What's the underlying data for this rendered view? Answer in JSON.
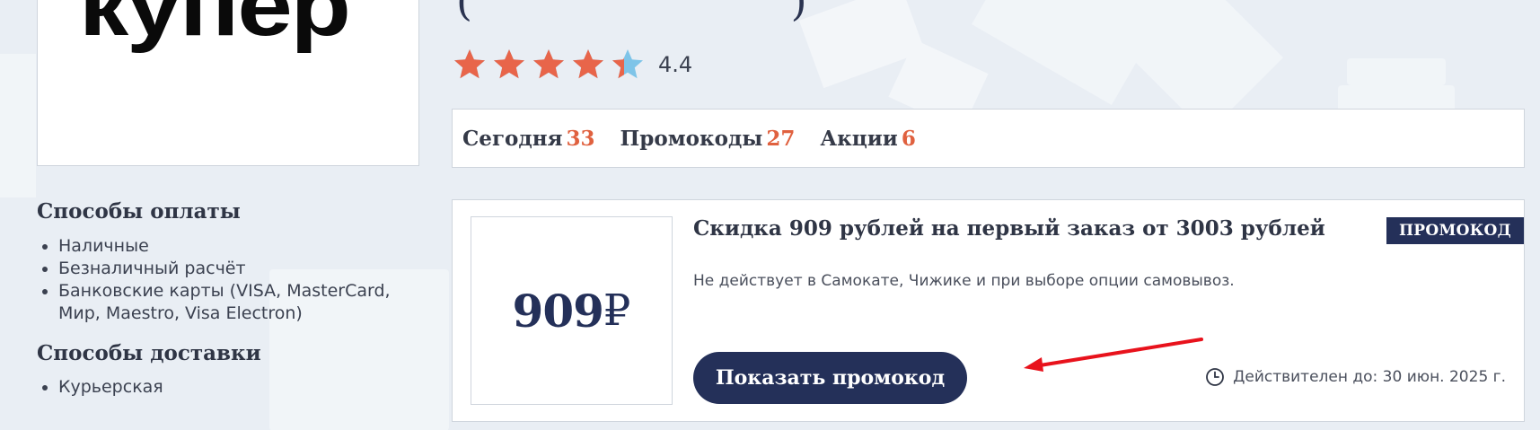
{
  "store": {
    "logo_text": "купер",
    "title_fragment": "(  )"
  },
  "rating": {
    "value": "4.4",
    "stars_filled": 4.4,
    "max_stars": 5,
    "filled_color": "#e8654a",
    "empty_color": "#7ec4e8"
  },
  "stats": [
    {
      "label": "Сегодня",
      "count": "33"
    },
    {
      "label": "Промокоды",
      "count": "27"
    },
    {
      "label": "Акции",
      "count": "6"
    }
  ],
  "sidebar": {
    "payment_heading": "Способы оплаты",
    "payment_methods": [
      "Наличные",
      "Безналичный расчёт",
      "Банковские карты (VISA, MasterCard, Мир, Maestro, Visa Electron)"
    ],
    "delivery_heading": "Способы доставки",
    "delivery_methods": [
      "Курьерская"
    ]
  },
  "coupon": {
    "value": "909",
    "currency": "₽",
    "title": "Скидка 909 рублей на первый заказ от 3003 рублей",
    "description": "Не действует в Самокате, Чижике и при выборе опции самовывоз.",
    "badge": "ПРОМОКОД",
    "button_label": "Показать промокод",
    "validity": "Действителен до: 30 июн. 2025 г."
  },
  "colors": {
    "accent": "#243059",
    "count_color": "#e0613f",
    "annotation_arrow": "#e8121c",
    "background": "#e9eef4"
  }
}
